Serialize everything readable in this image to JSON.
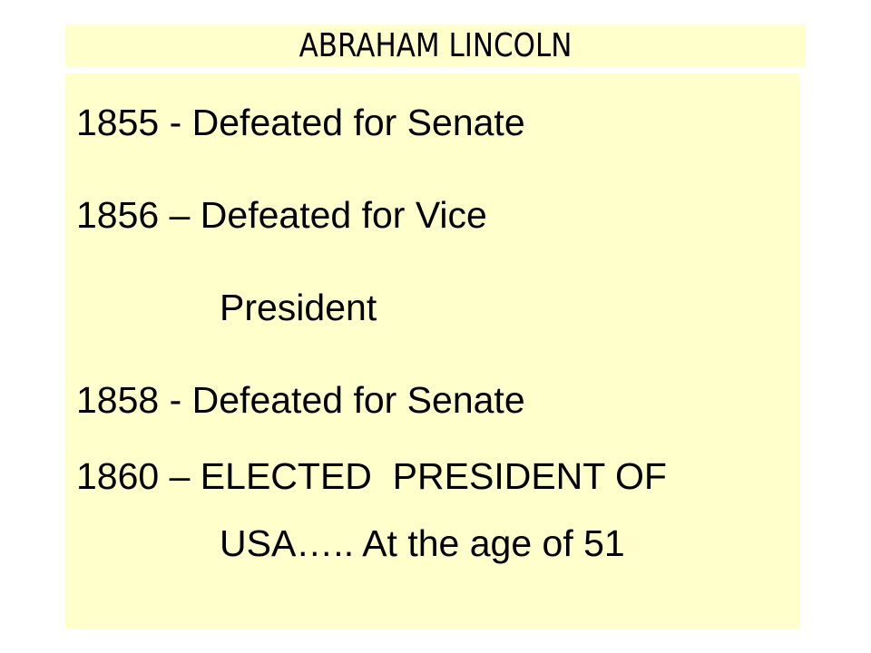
{
  "slide": {
    "title": "ABRAHAM LINCOLN",
    "background_color": "#ffffcc",
    "lines": [
      "1855 - Defeated for Senate",
      "1856 – Defeated for Vice",
      "President",
      "1858 - Defeated for Senate",
      "1860 – ELECTED  PRESIDENT OF",
      "USA….. At the age of 51"
    ]
  }
}
